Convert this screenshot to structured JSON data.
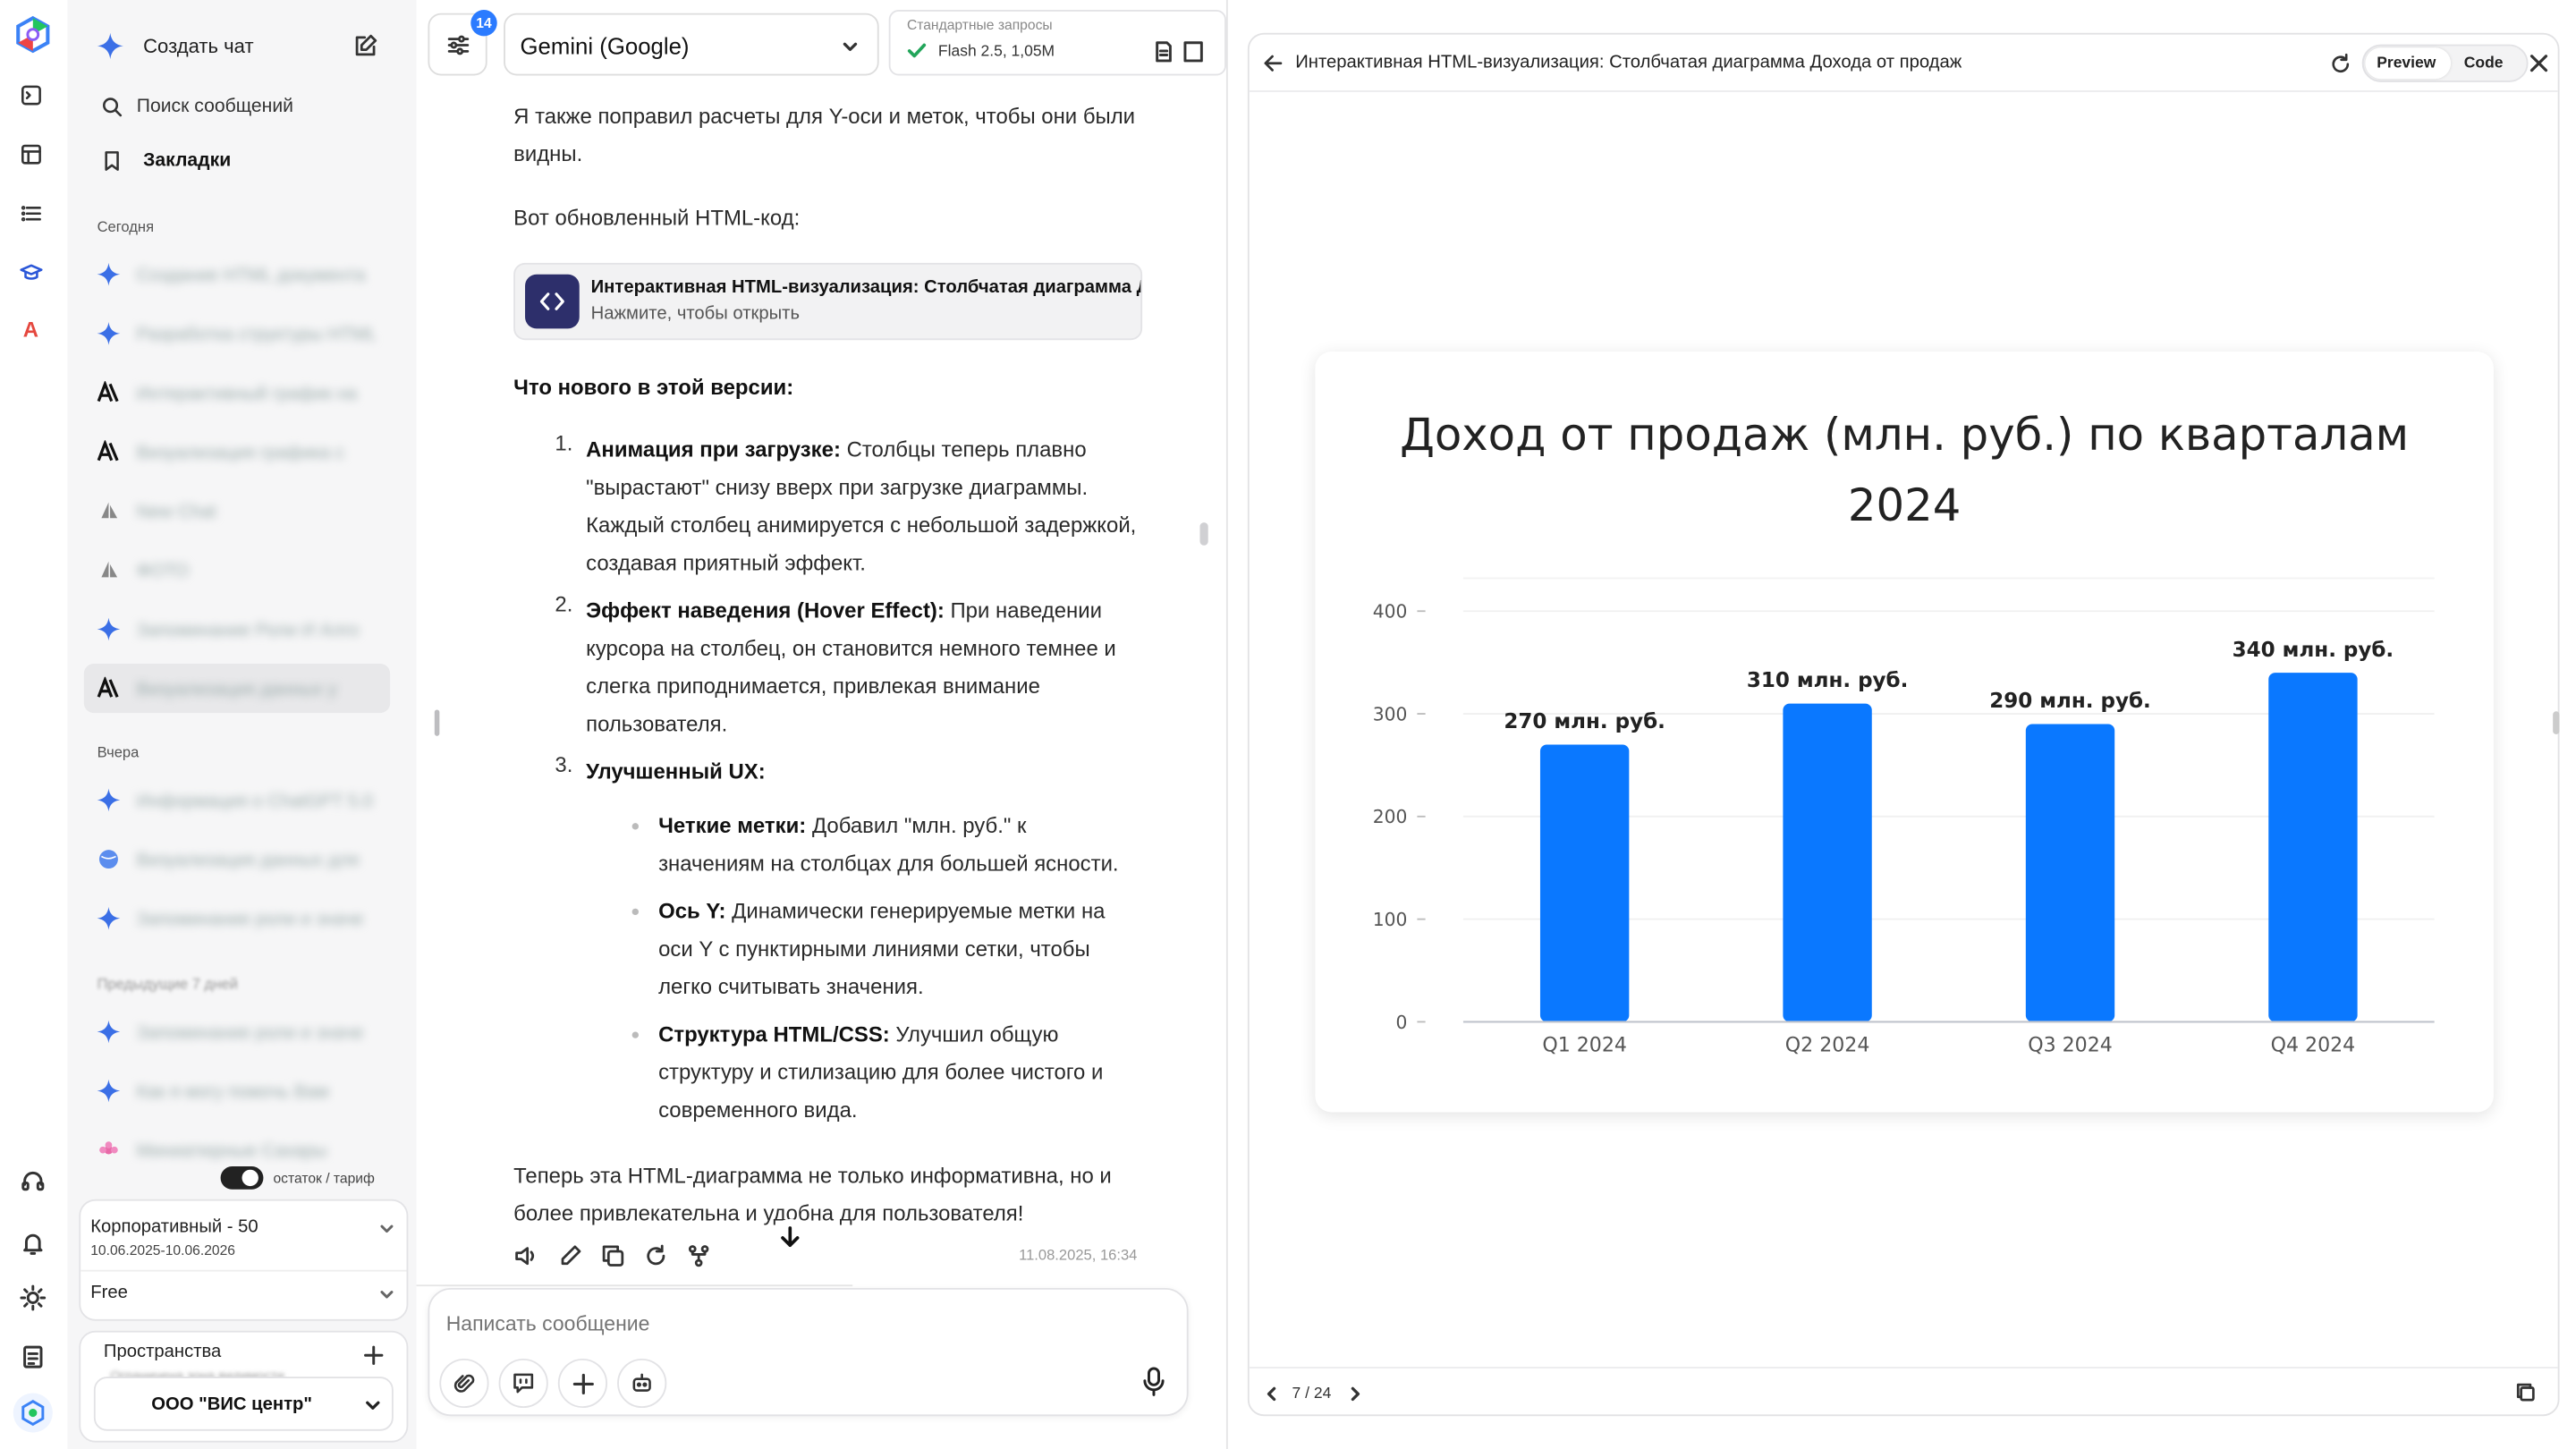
{
  "sidebar": {
    "new_chat": "Создать чат",
    "search": "Поиск сообщений",
    "bookmarks": "Закладки",
    "section_today": "Сегодня",
    "section_yesterday": "Вчера",
    "section_prev": "Предыдущие 7 дней",
    "history": [
      {
        "icon": "gemini-icon",
        "title": "Создание HTML документа"
      },
      {
        "icon": "gemini-icon",
        "title": "Разработка структуры HTML"
      },
      {
        "icon": "anthropic-icon",
        "title": "Интерактивный график на"
      },
      {
        "icon": "anthropic-icon",
        "title": "Визуализация графика с"
      },
      {
        "icon": "sail-icon",
        "title": "New Chat"
      },
      {
        "icon": "sail-icon",
        "title": "ФОТО"
      },
      {
        "icon": "gemini-icon",
        "title": "Запоминание Роли И Алго"
      },
      {
        "icon": "anthropic-icon",
        "title": "Визуализация данных у"
      },
      {
        "icon": "gemini-icon",
        "title": "Информация о ChatGPT 5.0"
      },
      {
        "icon": "globe-icon",
        "title": "Визуализация данных для"
      },
      {
        "icon": "gemini-icon",
        "title": "Запоминание роли и значе"
      },
      {
        "icon": "gemini-icon",
        "title": "Запоминание роли и значе"
      },
      {
        "icon": "gemini-icon",
        "title": "Как я могу помочь Вам"
      },
      {
        "icon": "lotus-icon",
        "title": "Миниатюрные Сахары"
      }
    ],
    "balance_toggle": "остаток / тариф",
    "plan_name": "Корпоративный - 50",
    "plan_dates": "10.06.2025-10.06.2026",
    "plan_free": "Free",
    "spaces_title": "Пространства",
    "spaces_sub": "Ограничена зона видимости",
    "org": "ООО \"ВИС центр\""
  },
  "chat": {
    "badge": "14",
    "model": "Gemini (Google)",
    "mode_title": "Стандартные запросы",
    "mode_value": "Flash 2.5, 1,05M",
    "p1": "Я также поправил расчеты для Y-оси и меток, чтобы они были видны.",
    "p2": "Вот обновленный HTML-код:",
    "artifact_title": "Интерактивная HTML-визуализация: Столбчатая диаграмма Дохода от продаж",
    "artifact_sub": "Нажмите, чтобы открыть",
    "whats_new": "Что нового в этой версии:",
    "items": [
      {
        "n": "1.",
        "title": "Анимация при загрузке:",
        "text": " Столбцы теперь плавно \"вырастают\" снизу вверх при загрузке диаграммы. Каждый столбец анимируется с небольшой задержкой, создавая приятный эффект."
      },
      {
        "n": "2.",
        "title": "Эффект наведения (Hover Effect):",
        "text": " При наведении курсора на столбец, он становится немного темнее и слегка приподнимается, привлекая внимание пользователя."
      },
      {
        "n": "3.",
        "title": "Улучшенный UX:",
        "text": ""
      }
    ],
    "sub_items": [
      {
        "title": "Четкие метки:",
        "text": " Добавил \"млн. руб.\" к значениям на столбцах для большей ясности."
      },
      {
        "title": "Ось Y:",
        "text": " Динамически генерируемые метки на оси Y с пунктирными линиями сетки, чтобы легко считывать значения."
      },
      {
        "title": "Структура HTML/CSS:",
        "text": " Улучшил общую структуру и стилизацию для более чистого и современного вида."
      }
    ],
    "closing": "Теперь эта HTML-диаграмма не только информативна, но и более привлекательна и удобна для пользователя!",
    "timestamp": "11.08.2025, 16:34",
    "input_placeholder": "Написать сообщение"
  },
  "panel": {
    "title": "Интерактивная HTML-визуализация: Столбчатая диаграмма Дохода от продаж",
    "preview_tab": "Preview",
    "code_tab": "Code",
    "pager": "7 / 24"
  },
  "colors": {
    "bar": "#0a78ff",
    "accent": "#2b7bff",
    "artifact_icon_bg": "#2d2f6b"
  },
  "chart_data": {
    "type": "bar",
    "title": "Доход от продаж (млн. руб.) по кварталам 2024",
    "categories": [
      "Q1 2024",
      "Q2 2024",
      "Q3 2024",
      "Q4 2024"
    ],
    "values": [
      270,
      310,
      290,
      340
    ],
    "data_labels": [
      "270 млн. руб.",
      "310 млн. руб.",
      "290 млн. руб.",
      "340 млн. руб."
    ],
    "yticks": [
      0,
      100,
      200,
      300,
      400
    ],
    "ylim": [
      0,
      400
    ],
    "xlabel": "",
    "ylabel": "",
    "grid": true
  }
}
